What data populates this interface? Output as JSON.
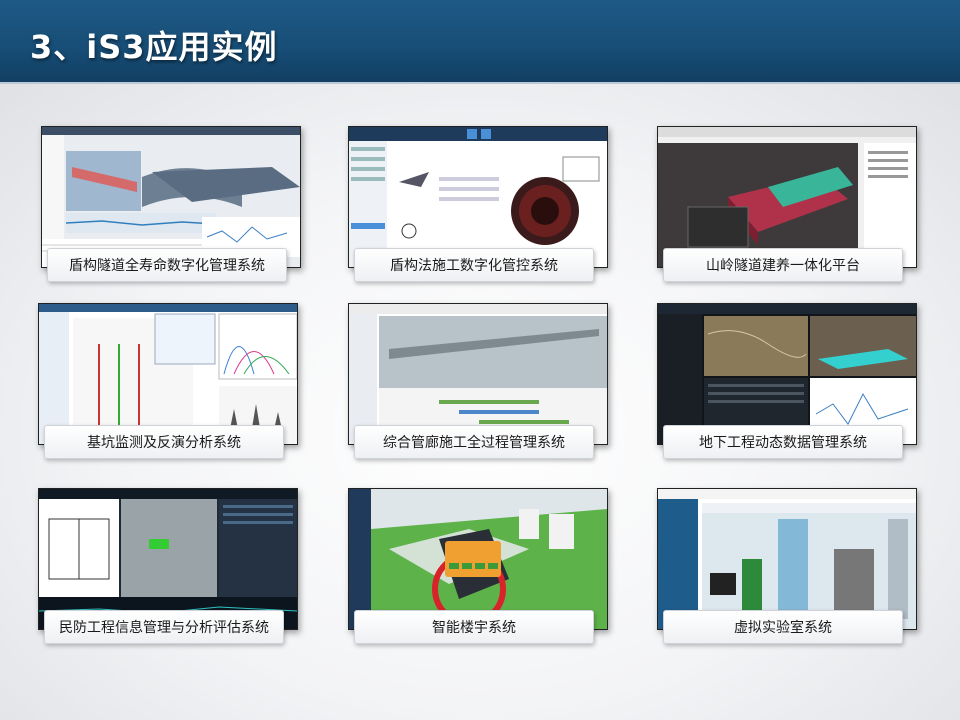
{
  "header": {
    "title": "3、iS3应用实例"
  },
  "cards": [
    {
      "label": "盾构隧道全寿命数字化管理系统"
    },
    {
      "label": "盾构法施工数字化管控系统"
    },
    {
      "label": "山岭隧道建养一体化平台"
    },
    {
      "label": "基坑监测及反演分析系统"
    },
    {
      "label": "综合管廊施工全过程管理系统"
    },
    {
      "label": "地下工程动态数据管理系统"
    },
    {
      "label": "民防工程信息管理与分析评估系统"
    },
    {
      "label": "智能楼宇系统"
    },
    {
      "label": "虚拟实验室系统"
    }
  ]
}
